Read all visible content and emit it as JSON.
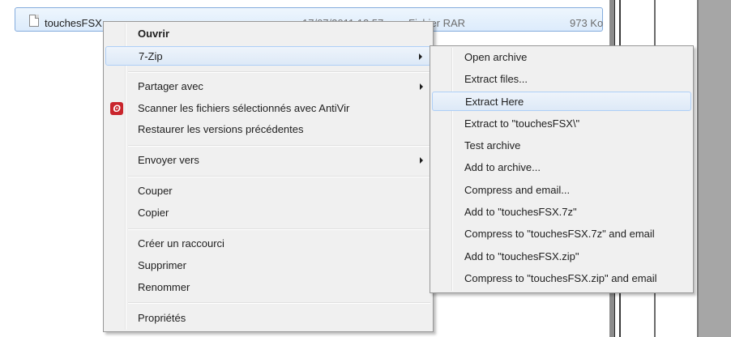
{
  "file": {
    "name": "touchesFSX",
    "date": "17/07/2011 13:57",
    "type": "Fichier RAR",
    "size": "973 Ko"
  },
  "menu": {
    "items": [
      {
        "label": "Ouvrir"
      },
      {
        "label": "7-Zip"
      },
      {
        "label": "Partager avec"
      },
      {
        "label": "Scanner les fichiers sélectionnés avec AntiVir"
      },
      {
        "label": "Restaurer les versions précédentes"
      },
      {
        "label": "Envoyer vers"
      },
      {
        "label": "Couper"
      },
      {
        "label": "Copier"
      },
      {
        "label": "Créer un raccourci"
      },
      {
        "label": "Supprimer"
      },
      {
        "label": "Renommer"
      },
      {
        "label": "Propriétés"
      }
    ]
  },
  "submenu": {
    "items": [
      {
        "label": "Open archive"
      },
      {
        "label": "Extract files..."
      },
      {
        "label": "Extract Here"
      },
      {
        "label": "Extract to \"touchesFSX\\\""
      },
      {
        "label": "Test archive"
      },
      {
        "label": "Add to archive..."
      },
      {
        "label": "Compress and email..."
      },
      {
        "label": "Add to \"touchesFSX.7z\""
      },
      {
        "label": "Compress to \"touchesFSX.7z\" and email"
      },
      {
        "label": "Add to \"touchesFSX.zip\""
      },
      {
        "label": "Compress to \"touchesFSX.zip\" and email"
      }
    ]
  }
}
